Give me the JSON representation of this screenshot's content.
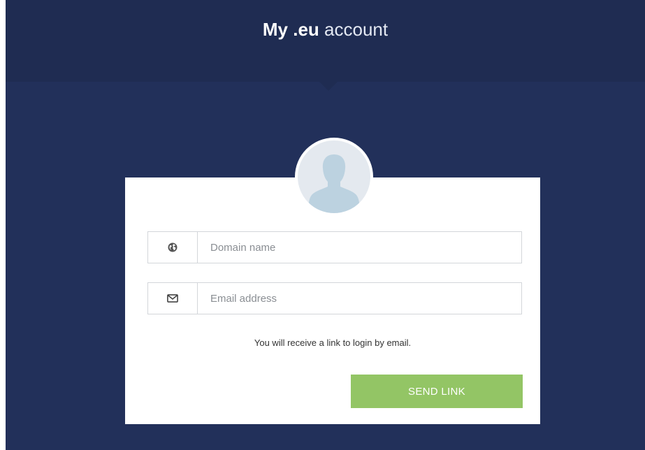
{
  "header": {
    "title_brand": "My .eu",
    "title_rest": " account"
  },
  "avatar": {
    "icon": "user-silhouette-icon"
  },
  "form": {
    "domain": {
      "icon": "globe-icon",
      "placeholder": "Domain name",
      "value": ""
    },
    "email": {
      "icon": "envelope-icon",
      "placeholder": "Email address",
      "value": ""
    },
    "hint": "You will receive a link to login by email.",
    "submit_label": "SEND LINK"
  },
  "colors": {
    "background": "#22305a",
    "header": "#1f2c52",
    "button": "#93c565"
  }
}
